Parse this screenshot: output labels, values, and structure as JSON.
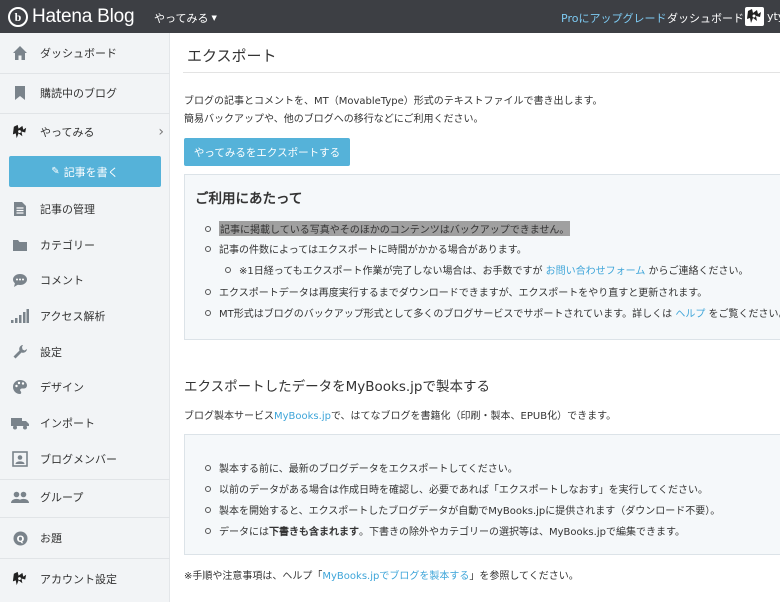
{
  "topbar": {
    "logo_letter": "b",
    "logo_text": "Hatena Blog",
    "blog_switch": "やってみる",
    "pro_link": "Proにアップグレード",
    "dashboard_link": "ダッシュボード",
    "user": "ytyaru"
  },
  "sidebar": {
    "dashboard": "ダッシュボード",
    "reading": "購読中のブログ",
    "blog": "やってみる",
    "write_button": "記事を書く",
    "manage": "記事の管理",
    "category": "カテゴリー",
    "comment": "コメント",
    "access": "アクセス解析",
    "settings": "設定",
    "design": "デザイン",
    "import": "インポート",
    "members": "ブログメンバー",
    "group": "グループ",
    "odai": "お題",
    "account": "アカウント設定"
  },
  "main": {
    "title": "エクスポート",
    "desc_line1": "ブログの記事とコメントを、MT（MovableType）形式のテキストファイルで書き出します。",
    "desc_line2": "簡易バックアップや、他のブログへの移行などにご利用ください。",
    "export_button": "やってみるをエクスポートする",
    "notice": {
      "heading": "ご利用にあたって",
      "item1": "記事に掲載している写真やそのほかのコンテンツはバックアップできません。",
      "item2": "記事の件数によってはエクスポートに時間がかかる場合があります。",
      "item2_sub_before": "※1日経ってもエクスポート作業が完了しない場合は、お手数ですが",
      "item2_sub_link": "お問い合わせフォーム",
      "item2_sub_after": "からご連絡ください。",
      "item3": "エクスポートデータは再度実行するまでダウンロードできますが、エクスポートをやり直すと更新されます。",
      "item4_before": "MT形式はブログのバックアップ形式として多くのブログサービスでサポートされています。詳しくは",
      "item4_link": "ヘルプ",
      "item4_after": "をご覧ください。"
    },
    "mybooks": {
      "title": "エクスポートしたデータをMyBooks.jpで製本する",
      "desc_before": "ブログ製本サービス",
      "desc_link": "MyBooks.jp",
      "desc_after": "で、はてなブログを書籍化（印刷・製本、EPUB化）できます。",
      "item1": "製本する前に、最新のブログデータをエクスポートしてください。",
      "item2": "以前のデータがある場合は作成日時を確認し、必要であれば「エクスポートしなおす」を実行してください。",
      "item3": "製本を開始すると、エクスポートしたブログデータが自動でMyBooks.jpに提供されます（ダウンロード不要）。",
      "item4_before": "データには",
      "item4_bold": "下書きも含まれます",
      "item4_after": "。下書きの除外やカテゴリーの選択等は、MyBooks.jpで編集できます。",
      "foot_before": "※手順や注意事項は、ヘルプ「",
      "foot_link": "MyBooks.jpでブログを製本する",
      "foot_after": "」を参照してください。"
    }
  },
  "colors": {
    "topbar": "#3d3f44",
    "accent": "#55b2d9",
    "link": "#3ea5d9",
    "sidebar_bg": "#f2f4f6"
  }
}
